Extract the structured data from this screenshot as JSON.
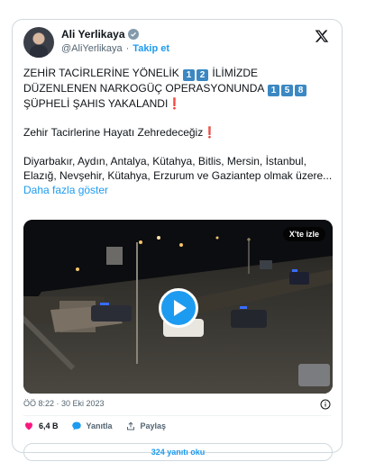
{
  "author": {
    "name": "Ali Yerlikaya",
    "handle": "@AliYerlikaya",
    "separator": "·",
    "follow_label": "Takip et"
  },
  "tweet": {
    "line1_prefix": "ZEHİR TACİRLERİNE YÖNELİK ",
    "line1_keycaps": [
      "1",
      "2"
    ],
    "line1_suffix": " İLİMİZDE",
    "line2_prefix": "DÜZENLENEN NARKOGÜÇ OPERASYONUNDA ",
    "line2_keycaps": [
      "1",
      "5",
      "8"
    ],
    "line3_text": "ŞÜPHELİ ŞAHIS YAKALANDI",
    "slogan": "Zehir Tacirlerine Hayatı Zehredeceğiz",
    "exclamation": "❗",
    "body": "Diyarbakır, Aydın, Antalya, Kütahya, Bitlis, Mersin, İstanbul, Elazığ, Nevşehir, Kütahya, Erzurum ve Gaziantep olmak üzere...",
    "more_label": "Daha fazla göster"
  },
  "media": {
    "watch_on_x_label": "X'te izle"
  },
  "meta": {
    "timestamp": "ÖÖ 8:22 · 30 Eki 2023"
  },
  "actions": {
    "likes": "6,4 B",
    "reply_label": "Yanıtla",
    "share_label": "Paylaş"
  },
  "read_replies_label": "324 yanıtı oku",
  "colors": {
    "accent": "#1d9bf0",
    "like": "#f91880",
    "keycap": "#3b88c3",
    "exclamation": "#dd2e44"
  },
  "icons": [
    "verified-icon",
    "x-logo-icon",
    "play-icon",
    "info-icon",
    "heart-icon",
    "reply-icon",
    "share-icon"
  ]
}
